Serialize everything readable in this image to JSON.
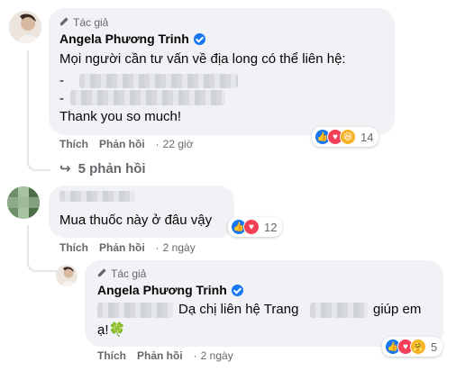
{
  "comment1": {
    "author_tag": "Tác giả",
    "author_name": "Angela Phương Trinh",
    "line1": "Mọi người cần tư vấn về địa long có thể liên hệ:",
    "dash1": "-",
    "dash2": "-",
    "line4": "Thank you so much!",
    "like_label": "Thích",
    "reply_label": "Phản hồi",
    "time": "22 giờ",
    "reaction_count": "14"
  },
  "replies_toggle": {
    "arrow": "↪",
    "label": "5 phản hồi"
  },
  "comment2": {
    "author_name_partial": "Phan Thị Lê",
    "text": "Mua thuốc này ở đâu vậy",
    "like_label": "Thích",
    "reply_label": "Phản hồi",
    "time": "2 ngày",
    "reaction_count": "12"
  },
  "comment3": {
    "author_tag": "Tác giả",
    "author_name": "Angela Phương Trinh",
    "text_part": "Dạ chị liên hệ Trang",
    "text_end": "giúp em",
    "line2": "ạ!🍀",
    "like_label": "Thích",
    "reply_label": "Phản hồi",
    "time": "2 ngày",
    "reaction_count": "5"
  },
  "colors": {
    "bubble": "#f0f2f5",
    "verified": "#1877f2",
    "meta_text": "#65676b",
    "like": "#1877f2",
    "love": "#f33e58",
    "haha": "#f7b125"
  }
}
